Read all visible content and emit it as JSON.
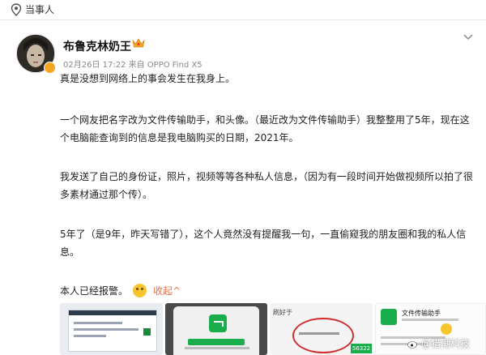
{
  "topbar": {
    "label": "当事人"
  },
  "post": {
    "username": "布鲁克林奶王",
    "meta": "02月26日 17:22 来自 OPPO Find X5",
    "paragraphs": [
      "真是没想到网络上的事会发生在我身上。",
      "一个网友把名字改为文件传输助手，和头像。（最近改为文件传输助手）我整整用了5年，现在这个电脑能查询到的信息是我电脑购买的日期，2021年。",
      "我发送了自己的身份证，照片，视频等等各种私人信息，（因为有一段时间开始做视频所以拍了很多素材通过那个传）。",
      "5年了（是9年，昨天写错了），这个人竟然没有提醒我一句，一直偷窥我的朋友圈和我的私人信息。"
    ],
    "closing_text": "本人已经报警。",
    "collapse_label": "收起",
    "collapse_arrow": "^"
  },
  "thumbnails": {
    "t3_label": "刷好于",
    "t3_tag": "56322",
    "t4_title": "文件传输助手"
  },
  "watermark": {
    "text": "@猎潮科技"
  },
  "colors": {
    "accent": "#eb7350",
    "wechat_green": "#1aad4b",
    "circle_red": "#d12f2f"
  }
}
